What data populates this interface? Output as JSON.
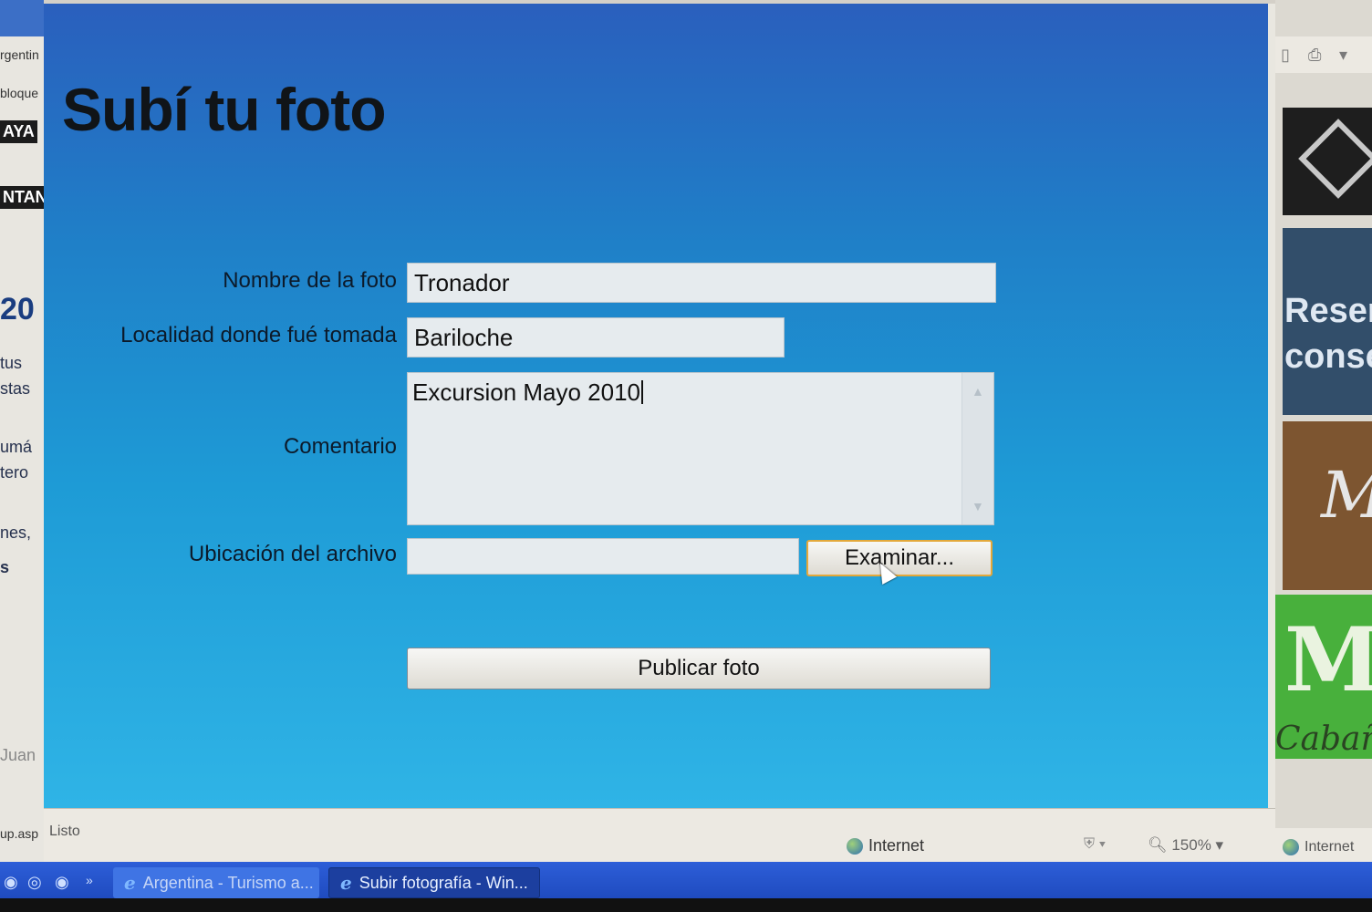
{
  "page": {
    "title": "Subí tu foto"
  },
  "form": {
    "nombre_label": "Nombre de la foto",
    "nombre_value": "Tronador",
    "localidad_label": "Localidad donde fué tomada",
    "localidad_value": "Bariloche",
    "comentario_label": "Comentario",
    "comentario_value": "Excursion Mayo 2010",
    "archivo_label": "Ubicación del archivo",
    "archivo_value": "",
    "examinar_label": "Examinar...",
    "publicar_label": "Publicar foto"
  },
  "statusbar": {
    "status_text": "Listo",
    "zone_text": "Internet",
    "zone_icon": "globe-icon",
    "zoom_text": "150%"
  },
  "taskbar": {
    "tasks": [
      {
        "label": "Argentina - Turismo a...",
        "icon": "internet-explorer-icon",
        "active": false
      },
      {
        "label": "Subir fotografía - Win...",
        "icon": "internet-explorer-icon",
        "active": true
      }
    ]
  },
  "background_window": {
    "left_fragments": [
      "rgentin",
      "bloque",
      "AYA",
      "NTAN",
      "20",
      "tus",
      "stas",
      "umá",
      "tero",
      "nes,",
      "s",
      "Juan",
      "up.asp"
    ],
    "right_fragments": [
      "Reser",
      "conse",
      "M",
      "M",
      "Cabaña"
    ],
    "status_text": "Internet"
  }
}
